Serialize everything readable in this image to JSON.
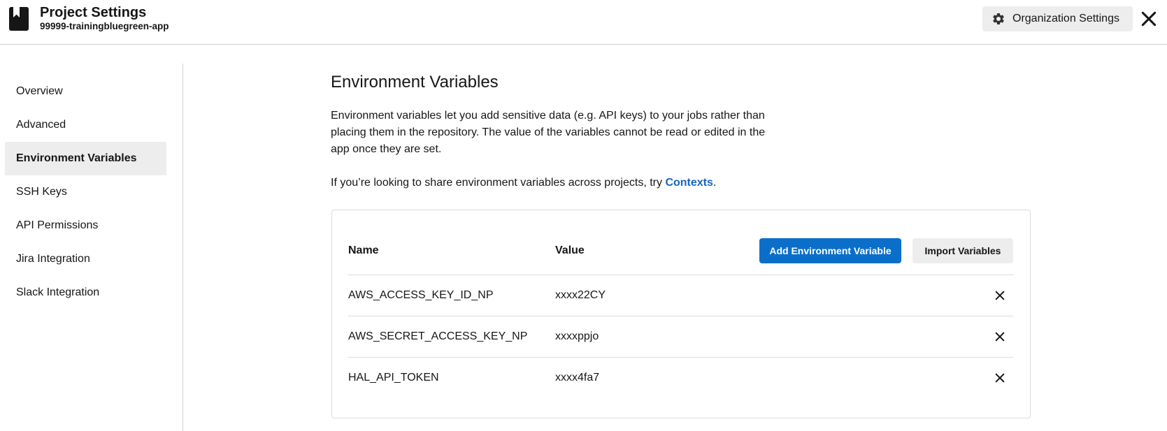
{
  "header": {
    "title": "Project Settings",
    "subtitle": "99999-trainingbluegreen-app",
    "project_icon": "bookmark-icon",
    "org_settings_label": "Organization Settings",
    "org_settings_icon": "gear-icon",
    "close_icon": "close-icon"
  },
  "sidebar": {
    "items": [
      {
        "label": "Overview",
        "active": false
      },
      {
        "label": "Advanced",
        "active": false
      },
      {
        "label": "Environment Variables",
        "active": true
      },
      {
        "label": "SSH Keys",
        "active": false
      },
      {
        "label": "API Permissions",
        "active": false
      },
      {
        "label": "Jira Integration",
        "active": false
      },
      {
        "label": "Slack Integration",
        "active": false
      }
    ]
  },
  "main": {
    "heading": "Environment Variables",
    "description": "Environment variables let you add sensitive data (e.g. API keys) to your jobs rather than placing them in the repository. The value of the variables cannot be read or edited in the app once they are set.",
    "share_text": "If you’re looking to share environment variables across projects, try ",
    "share_link": "Contexts",
    "share_suffix": "."
  },
  "table": {
    "columns": [
      "Name",
      "Value"
    ],
    "add_button_label": "Add Environment Variable",
    "import_button_label": "Import Variables",
    "rows": [
      {
        "name": "AWS_ACCESS_KEY_ID_NP",
        "value": "xxxx22CY"
      },
      {
        "name": "AWS_SECRET_ACCESS_KEY_NP",
        "value": "xxxxppjo"
      },
      {
        "name": "HAL_API_TOKEN",
        "value": "xxxx4fa7"
      }
    ]
  },
  "colors": {
    "primary": "#0b6fca",
    "link": "#1565c0",
    "active_bg": "#ededed",
    "border": "#d0d0d0"
  }
}
